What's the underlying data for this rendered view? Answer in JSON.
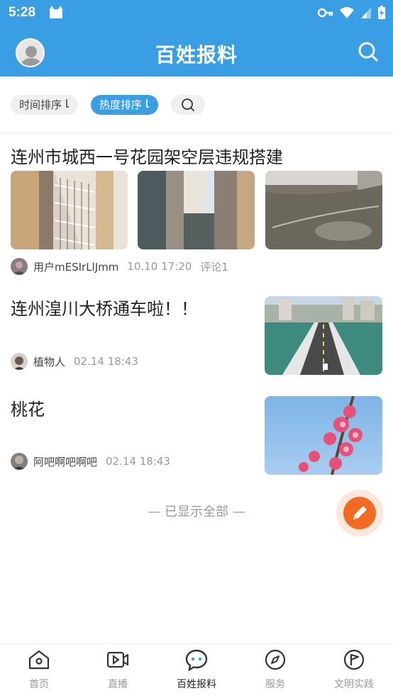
{
  "status": {
    "time": "5:28"
  },
  "header": {
    "title": "百姓报料"
  },
  "filters": {
    "time_sort": "时间排序",
    "hot_sort": "热度排序"
  },
  "posts": [
    {
      "title": "连州市城西一号花园架空层违规搭建",
      "author": "用户mESIrLlJmm",
      "time": "10.10 17:20",
      "comments": "评论1"
    },
    {
      "title": "连州湟川大桥通车啦！！",
      "author": "植物人",
      "time": "02.14 18:43"
    },
    {
      "title": "桃花",
      "author": "阿吧啊吧啊吧",
      "time": "02.14 18:43"
    }
  ],
  "end_text": "—  已显示全部  —",
  "nav": {
    "items": [
      {
        "label": "首页",
        "icon": "home-icon"
      },
      {
        "label": "直播",
        "icon": "video-icon"
      },
      {
        "label": "百姓报料",
        "icon": "chat-icon",
        "active": true
      },
      {
        "label": "服务",
        "icon": "compass-icon"
      },
      {
        "label": "文明实践",
        "icon": "flag-icon"
      }
    ]
  },
  "colors": {
    "primary": "#3a9ee4",
    "fab": "#f26b22",
    "fab_halo": "#fde7dc"
  }
}
